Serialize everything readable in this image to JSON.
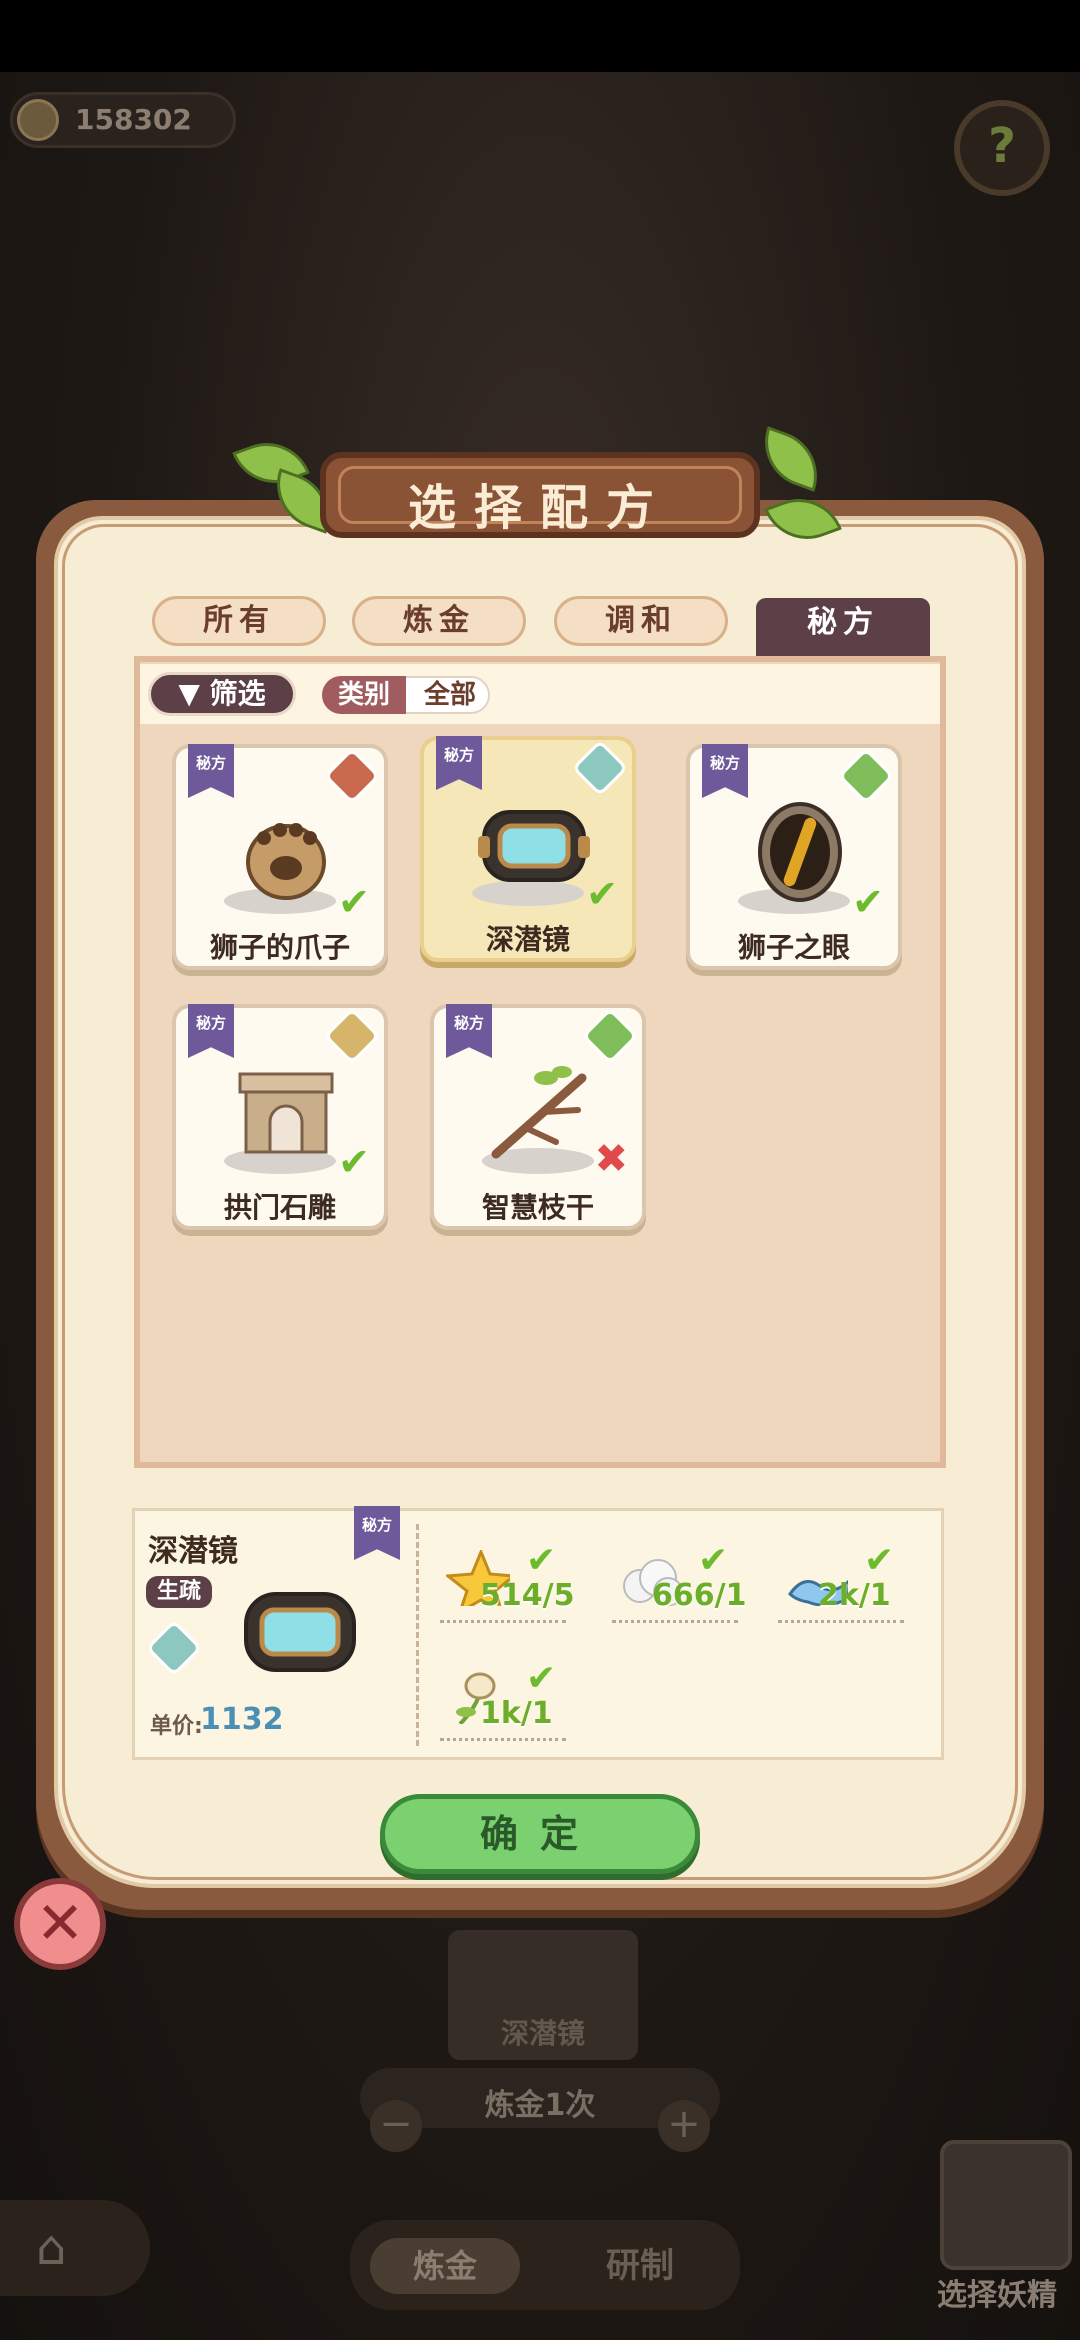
{
  "hud": {
    "coins": "158302",
    "help_symbol": "?"
  },
  "background": {
    "card_label": "深潜镜",
    "alchemy_count": "炼金1次",
    "minus": "−",
    "plus": "+",
    "tabs": [
      "炼金",
      "研制"
    ],
    "select_fairy": "选择妖精"
  },
  "dialog": {
    "title": "选择配方",
    "tabs": [
      {
        "label": "所有",
        "active": false
      },
      {
        "label": "炼金",
        "active": false
      },
      {
        "label": "调和",
        "active": false
      },
      {
        "label": "秘方",
        "active": true
      }
    ],
    "filter": {
      "button_label": "筛选",
      "category_label": "类别",
      "category_value": "全部"
    },
    "recipes": [
      {
        "tag": "秘方",
        "name": "狮子的爪子",
        "status": "✔",
        "badge": "red"
      },
      {
        "tag": "秘方",
        "name": "深潜镜",
        "status": "✔",
        "badge": "teal",
        "selected": true
      },
      {
        "tag": "秘方",
        "name": "狮子之眼",
        "status": "✔",
        "badge": "green"
      },
      {
        "tag": "秘方",
        "name": "拱门石雕",
        "status": "✔",
        "badge": "tan"
      },
      {
        "tag": "秘方",
        "name": "智慧枝干",
        "status": "✖",
        "badge": "green"
      }
    ],
    "detail": {
      "name": "深潜镜",
      "tag": "秘方",
      "proficiency": "生疏",
      "price_label": "单价:",
      "price": "1132",
      "materials": [
        {
          "icon": "star-icon",
          "amount": "514/5",
          "check": "✔"
        },
        {
          "icon": "cotton-icon",
          "amount": "666/1",
          "check": "✔"
        },
        {
          "icon": "water-icon",
          "amount": "2k/1",
          "check": "✔"
        },
        {
          "icon": "flower-icon",
          "amount": "1k/1",
          "check": "✔"
        }
      ]
    },
    "confirm_label": "确定",
    "close_symbol": "✕"
  }
}
